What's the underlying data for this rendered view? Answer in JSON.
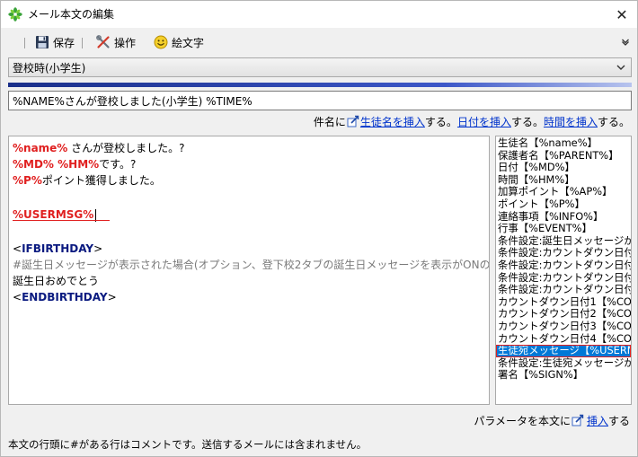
{
  "window": {
    "title": "メール本文の編集",
    "close_label": "✕"
  },
  "toolbar": {
    "save_label": "保存",
    "operation_label": "操作",
    "emoji_label": "絵文字"
  },
  "template_select": {
    "selected": "登校時(小学生)"
  },
  "subject": {
    "value": "%NAME%さんが登校しました(小学生)  %TIME%"
  },
  "subject_hint": {
    "prefix": "件名に",
    "link_student": "生徒名を挿入",
    "sep1": "する。",
    "link_date": "日付を挿入",
    "sep2": "する。",
    "link_time": "時間を挿入",
    "sep3": "する。"
  },
  "editor": {
    "line1_var": "%name%",
    "line1_text": "  さんが登校しました。?",
    "line2_var": "%MD%  %HM%",
    "line2_text": "です。?",
    "line3_var": "%P%",
    "line3_text": "ポイント獲得しました。",
    "line5_var": "%USERMSG%",
    "line7_open": "<",
    "line7_tag": "IFBIRTHDAY",
    "line7_close": ">",
    "line8_comment": "#誕生日メッセージが表示された場合(オプション、登下校2タブの誕生日メッセージを表示がONの場合)",
    "line9_text": "誕生日おめでとう",
    "line10_open": "<",
    "line10_tag": "ENDBIRTHDAY",
    "line10_close": ">"
  },
  "params": {
    "items": [
      "生徒名【%name%】",
      "保護者名【%PARENT%】",
      "日付【%MD%】",
      "時間【%HM%】",
      "加算ポイント【%AP%】",
      "ポイント【%P%】",
      "連絡事項【%INFO%】",
      "行事【%EVENT%】",
      "条件設定:誕生日メッセージが%",
      "条件設定:カウントダウン日付1",
      "条件設定:カウントダウン日付2",
      "条件設定:カウントダウン日付3",
      "条件設定:カウントダウン日付4",
      "カウントダウン日付1【%COUNT",
      "カウントダウン日付2【%COUNT",
      "カウントダウン日付3【%COUNT",
      "カウントダウン日付4【%COUNT",
      "生徒宛メッセージ【%USERMSG",
      "条件設定:生徒宛メッセージが",
      "署名【%SIGN%】"
    ],
    "selected_index": 17
  },
  "param_hint": {
    "prefix": "パラメータを本文に",
    "link": "挿入",
    "suffix": "する"
  },
  "footer": {
    "note": "本文の行頭に#がある行はコメントです。送信するメールには含まれません。"
  },
  "colors": {
    "accent_blue": "#0078d7",
    "var_red": "#e02020",
    "tag_navy": "#0a1a80",
    "link": "#0033cc"
  }
}
